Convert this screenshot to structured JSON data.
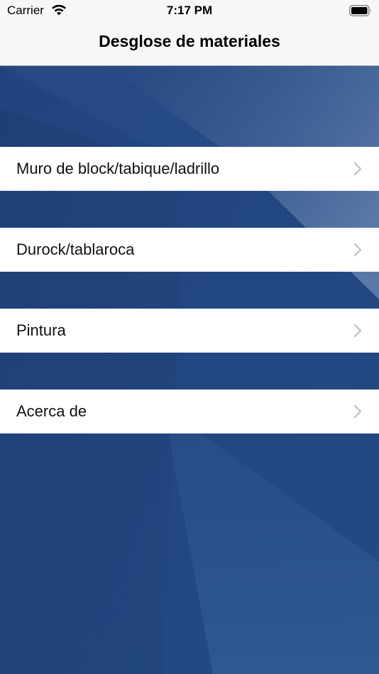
{
  "status_bar": {
    "carrier": "Carrier",
    "time": "7:17 PM",
    "icons": [
      "wifi-icon",
      "battery-icon"
    ]
  },
  "nav": {
    "title": "Desglose de materiales"
  },
  "menu": {
    "items": [
      {
        "label": "Muro de block/tabique/ladrillo",
        "icon": "chevron-right-icon"
      },
      {
        "label": "Durock/tablaroca",
        "icon": "chevron-right-icon"
      },
      {
        "label": "Pintura",
        "icon": "chevron-right-icon"
      },
      {
        "label": "Acerca de",
        "icon": "chevron-right-icon"
      }
    ]
  },
  "colors": {
    "nav_background": "#f7f7f7",
    "background_blue": "#27467f",
    "chevron": "#c4c4c7"
  }
}
